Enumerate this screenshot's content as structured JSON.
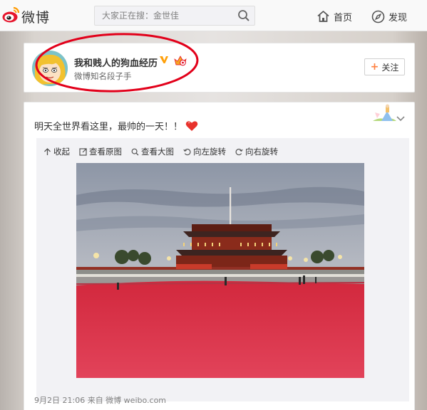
{
  "topbar": {
    "logo_text": "微博",
    "search_placeholder": "大家正在搜：金世佳",
    "nav_home": "首页",
    "nav_discover": "发现"
  },
  "profile": {
    "name": "我和贱人的狗血经历",
    "bio": "微博知名段子手",
    "follow_label": "关注",
    "follow_plus": "+"
  },
  "post": {
    "text": "明天全世界看这里，最帅的一天！！",
    "toolbar": {
      "collapse": "收起",
      "view_original": "查看原图",
      "view_large": "查看大图",
      "rotate_left": "向左旋转",
      "rotate_right": "向右旋转"
    },
    "meta": "9月2日 21:06 来自 微博 weibo.com"
  },
  "colors": {
    "brand_orange": "#ff8140",
    "annotation_red": "#e2001a",
    "verify_gold": "#ffa00a"
  },
  "icons": [
    "weibo-logo-icon",
    "search-icon",
    "home-icon",
    "compass-icon",
    "verified-v-icon",
    "level-crown-icon",
    "heart-icon",
    "chevron-down-icon",
    "collapse-up-icon",
    "view-original-icon",
    "magnifier-icon",
    "rotate-left-icon",
    "rotate-right-icon"
  ]
}
